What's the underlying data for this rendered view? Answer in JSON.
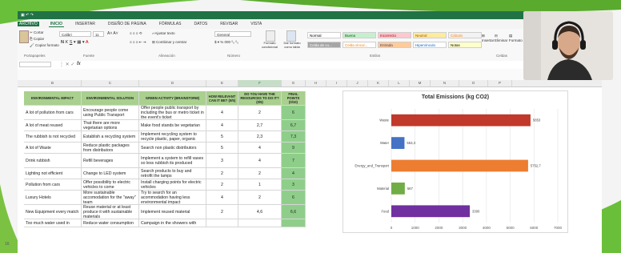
{
  "ribbon": {
    "tabs": [
      "ARCHIVO",
      "INICIO",
      "INSERTAR",
      "DISEÑO DE PÁGINA",
      "FÓRMULAS",
      "DATOS",
      "REVISAR",
      "VISTA"
    ],
    "active_tab": "INICIO",
    "clipboard": {
      "cut": "Cortar",
      "copy": "Copiar",
      "paste_format": "Copiar formato",
      "group": "Portapapeles"
    },
    "font": {
      "name": "Calibri",
      "size": "11",
      "group": "Fuente"
    },
    "alignment": {
      "wrap": "Ajustar texto",
      "merge": "Combinar y centrar",
      "group": "Alineación"
    },
    "number": {
      "format": "General",
      "group": "Número"
    },
    "styles": {
      "conditional": "Formato condicional",
      "as_table": "Dar formato como tabla",
      "cells": [
        {
          "label": "Normal",
          "bg": "#ffffff",
          "fg": "#000000"
        },
        {
          "label": "Buena",
          "bg": "#c6efce",
          "fg": "#006100"
        },
        {
          "label": "Incorrecto",
          "bg": "#ffc7ce",
          "fg": "#9c0006"
        },
        {
          "label": "Neutral",
          "bg": "#ffeb9c",
          "fg": "#9c5700"
        },
        {
          "label": "Cálculo",
          "bg": "#f2f2f2",
          "fg": "#fa7d00"
        },
        {
          "label": "Celda de co...",
          "bg": "#a5a5a5",
          "fg": "#ffffff"
        },
        {
          "label": "Celda vincul...",
          "bg": "#ffffff",
          "fg": "#fa7d00"
        },
        {
          "label": "Entrada",
          "bg": "#ffcc99",
          "fg": "#3f3f76"
        },
        {
          "label": "Hipervínculo",
          "bg": "#ffffff",
          "fg": "#0563c1"
        },
        {
          "label": "Notas",
          "bg": "#ffffcc",
          "fg": "#000000"
        }
      ],
      "group": "Estilos"
    },
    "cells_group": {
      "insert": "Insertar",
      "delete": "Eliminar",
      "format": "Formato",
      "group": "Celdas"
    }
  },
  "formula_bar": {
    "fx": "fx",
    "value": ""
  },
  "columns": [
    "B",
    "C",
    "D",
    "E",
    "F",
    "G",
    "H",
    "I",
    "J",
    "K",
    "L",
    "M",
    "N",
    "O",
    "P"
  ],
  "selected_column": "F",
  "table": {
    "headers": [
      "ENVIRONMENTAL IMPACT",
      "ENVIRONMENTAL SOLUTION",
      "GREEN ACTIVITY (BRAINSTORM)",
      "HOW RELEVANT CAN IT BE? (0/5)",
      "DO YOU HAVE THE RESOURCES TO DO IT? (0/5)",
      "FINAL POINTS (0/10)"
    ],
    "rows": [
      [
        "A lot of pollution from cars",
        "Encourage people come using Public Transport",
        "Offer people public transport by including the bus or metro ticket in the event's ticket",
        "4",
        "2",
        "6"
      ],
      [
        "A lot of meat reused",
        "That there are more vegetarian options",
        "Make food stands be vegetarian",
        "4",
        "2,7",
        "6,7"
      ],
      [
        "The rubbish is not recycled",
        "Establish a recycling system",
        "Implement recycling system to recycle plastic, paper, organic",
        "5",
        "2,3",
        "7,3"
      ],
      [
        "A lot of Waste",
        "Reduce plastic packages from distributors",
        "Search non plastic distributors",
        "5",
        "4",
        "9"
      ],
      [
        "Drink rubbish",
        "Refill beverages",
        "Implement a system to refill vases so less rubbish its produced",
        "3",
        "4",
        "7"
      ],
      [
        "Lighting not efficient",
        "Change to LED system",
        "Search products to buy and retrofit the lamps",
        "2",
        "2",
        "4"
      ],
      [
        "Pollution from cars",
        "Offer possibility to electric vehicles to come",
        "Install charging points for electric vehicles",
        "2",
        "1",
        "3"
      ],
      [
        "Luxury Hotels",
        "More sustainable accomodation for the \"away\" team",
        "Try to search for an acommodation having less environmental impact",
        "4",
        "2",
        "6"
      ],
      [
        "New Equipment every match",
        "Reuse material or at least produce it with sustainable materials",
        "Implement reused material",
        "2",
        "4,6",
        "6,6"
      ],
      [
        "Too much water used in",
        "Reduce water consumption",
        "Campaign in the showers with",
        "",
        "",
        ""
      ]
    ]
  },
  "chart_data": {
    "type": "bar",
    "orientation": "horizontal",
    "title": "Total Emissions (kg CO2)",
    "categories": [
      "Waste",
      "Water",
      "Energy_and_Transport",
      "Material",
      "Food"
    ],
    "values": [
      5853,
      553,
      5752,
      567,
      3300
    ],
    "value_labels": [
      "5853",
      "553,3",
      "5752,7",
      "567",
      "3300"
    ],
    "colors": [
      "#c0392b",
      "#4472c4",
      "#ed7d31",
      "#70ad47",
      "#7030a0"
    ],
    "xlim": [
      0,
      7000
    ],
    "xticks": [
      "0",
      "1000",
      "2000",
      "3000",
      "4000",
      "5000",
      "6000",
      "7000"
    ],
    "grid": true
  },
  "page_number": "16"
}
